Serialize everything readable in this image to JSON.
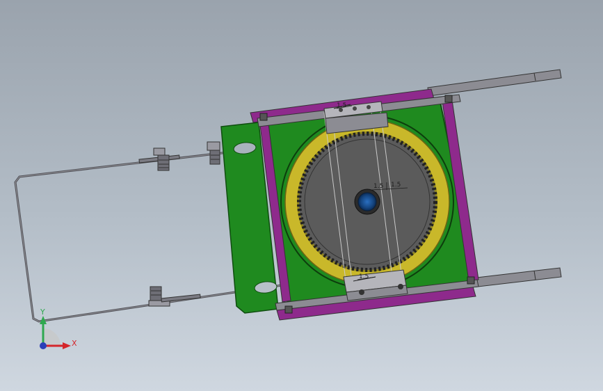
{
  "view": {
    "background_top": "#9aa3ad",
    "background_bottom": "#cfd7e0"
  },
  "annotations": {
    "top_weld": "1.5",
    "center_weld_left": "1.5",
    "center_weld_right": "1.5",
    "bottom_weld": "1.5"
  },
  "triad": {
    "x_label": "X",
    "y_label": "Y",
    "x_color": "#d4262b",
    "y_color": "#2fa84f",
    "z_color": "#2b3fb8"
  },
  "colors": {
    "plate": "#1f8a1f",
    "plate_edge": "#0f4d0f",
    "rail": "#8e2a8c",
    "gear_ring": "#c9b82a",
    "gear": "#5b5b5b",
    "hub": "#1a5aa3",
    "steel": "#7a7a82"
  },
  "icons": [
    "coordinate-triad-icon"
  ]
}
